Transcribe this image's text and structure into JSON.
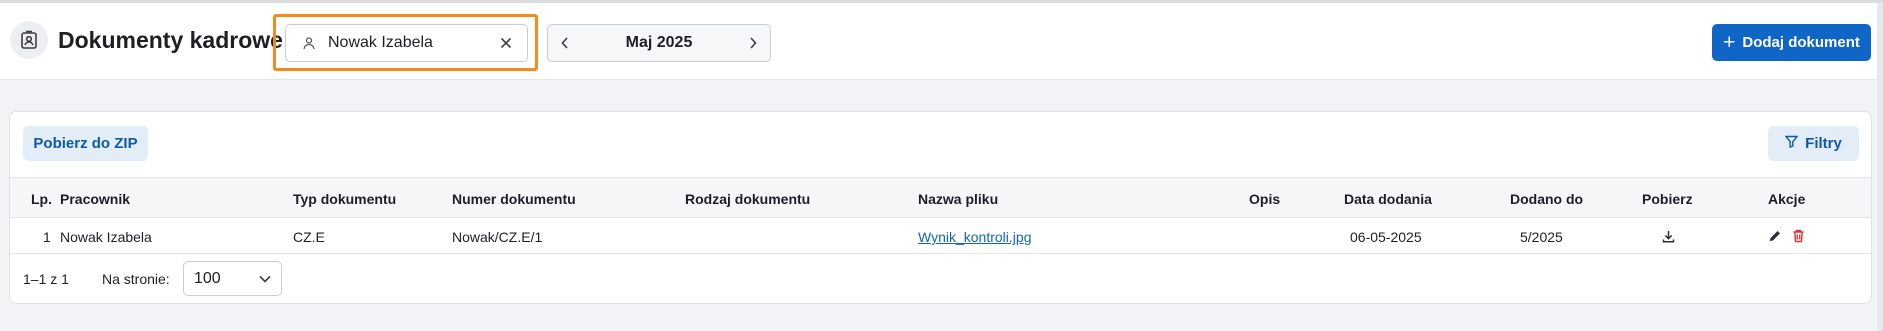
{
  "header": {
    "title": "Dokumenty kadrowe",
    "title_icon": "id-badge-icon",
    "employee_filter": {
      "value": "Nowak Izabela",
      "icon": "person-icon",
      "clear_icon": "close-icon"
    },
    "month_picker": {
      "label": "Maj 2025",
      "prev_icon": "chevron-left-icon",
      "next_icon": "chevron-right-icon"
    },
    "add_button": {
      "label": "Dodaj dokument",
      "icon": "plus-icon"
    },
    "highlight_color": "#f28a1e",
    "accent_color": "#0f66c7"
  },
  "toolbar": {
    "zip_label": "Pobierz do ZIP",
    "filter_label": "Filtry",
    "filter_icon": "filter-icon"
  },
  "table": {
    "columns": [
      "Lp.",
      "Pracownik",
      "Typ dokumentu",
      "Numer dokumentu",
      "Rodzaj dokumentu",
      "Nazwa pliku",
      "Opis",
      "Data dodania",
      "Dodano do",
      "Pobierz",
      "Akcje"
    ],
    "rows": [
      {
        "lp": "1",
        "employee": "Nowak Izabela",
        "doc_type": "CZ.E",
        "doc_number": "Nowak/CZ.E/1",
        "doc_kind": "",
        "file_name": "Wynik_kontroli.jpg",
        "description": "",
        "date_added": "06-05-2025",
        "added_to": "5/2025",
        "download_icon": "download-icon",
        "edit_icon": "pencil-icon",
        "delete_icon": "trash-icon"
      }
    ]
  },
  "pagination": {
    "range": "1–1 z 1",
    "per_page_label": "Na stronie:",
    "per_page_value": "100",
    "dropdown_icon": "chevron-down-icon"
  }
}
